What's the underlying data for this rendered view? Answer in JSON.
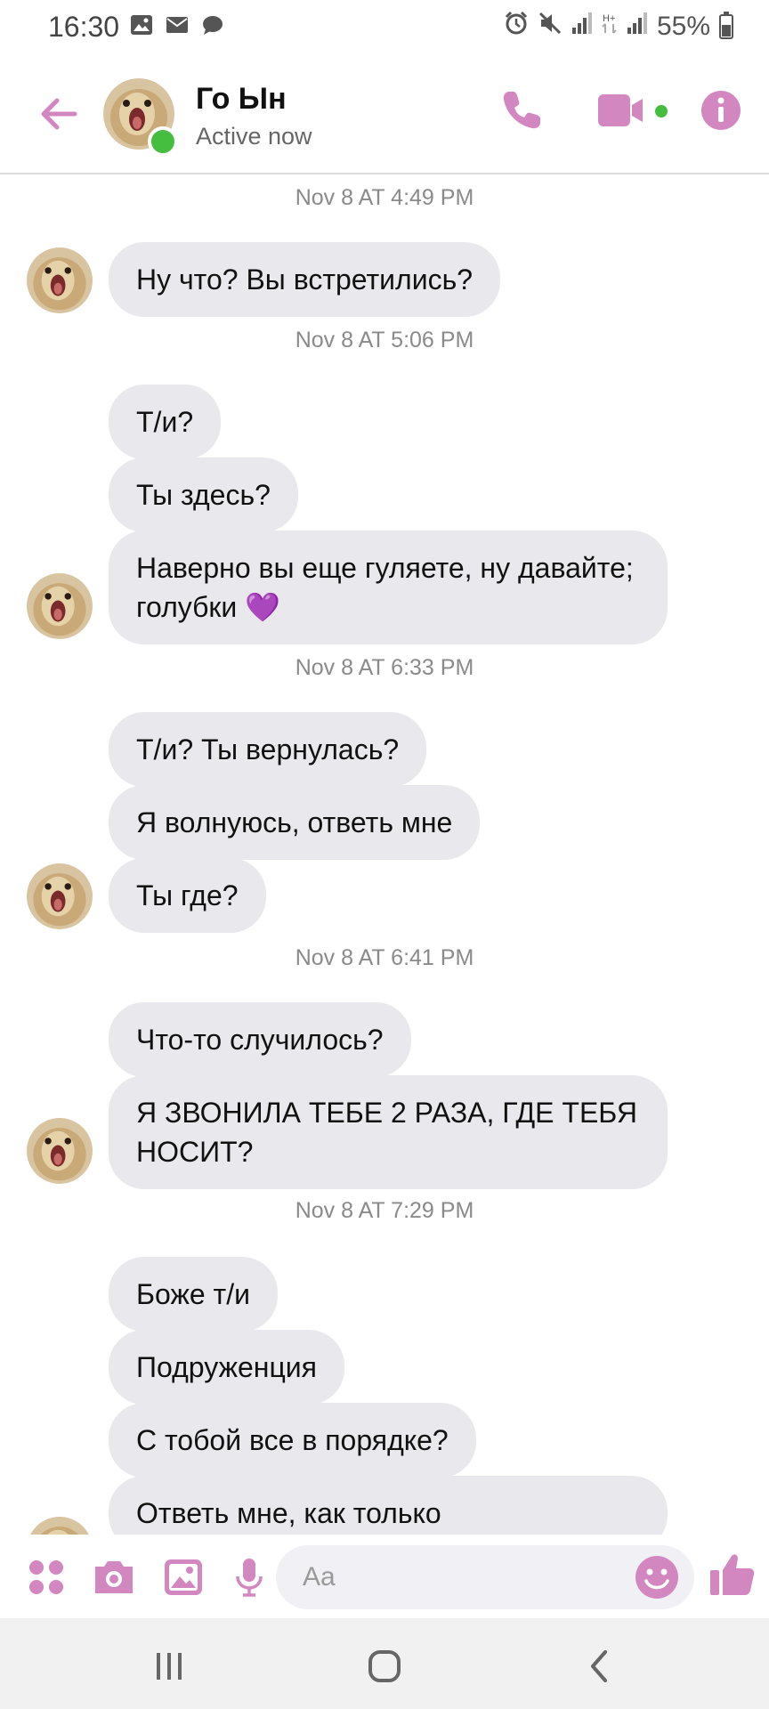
{
  "status_bar": {
    "time": "16:30",
    "battery": "55%",
    "left_icons": [
      "image-icon",
      "mail-icon",
      "chat-icon"
    ],
    "right_icons": [
      "alarm-icon",
      "mute-icon",
      "signal-icon",
      "hplus-icon",
      "signal-icon",
      "battery-icon"
    ]
  },
  "header": {
    "contact_name": "Го Ын",
    "status": "Active now",
    "accent_color": "#d287c0",
    "presence_color": "#45bd3f"
  },
  "messages": {
    "groups": [
      {
        "timestamp": "Nov 8 AT 4:49 PM",
        "bubbles": [
          "Ну что? Вы встретились?"
        ]
      },
      {
        "timestamp": "Nov 8 AT 5:06 PM",
        "bubbles": [
          "Т/и?",
          "Ты здесь?",
          "Наверно вы еще гуляете, ну давайте; голубки 💜"
        ]
      },
      {
        "timestamp": "Nov 8 AT 6:33 PM",
        "bubbles": [
          "Т/и? Ты вернулась?",
          "Я волнуюсь, ответь мне",
          "Ты где?"
        ]
      },
      {
        "timestamp": "Nov 8 AT 6:41 PM",
        "bubbles": [
          "Что-то случилось?",
          "Я ЗВОНИЛА ТЕБЕ 2 РАЗА, ГДЕ ТЕБЯ НОСИТ?"
        ]
      },
      {
        "timestamp": "Nov 8 AT 7:29 PM",
        "bubbles": [
          "Боже т/и",
          "Подруженция",
          "С тобой все в порядке?",
          "Ответь мне, как только"
        ]
      }
    ]
  },
  "composer": {
    "placeholder": "Aa",
    "icons": [
      "apps-icon",
      "camera-icon",
      "gallery-icon",
      "microphone-icon",
      "emoji-icon",
      "thumbs-up-icon"
    ]
  },
  "navbar": {
    "icons": [
      "recent-apps-icon",
      "home-icon",
      "back-icon"
    ]
  }
}
